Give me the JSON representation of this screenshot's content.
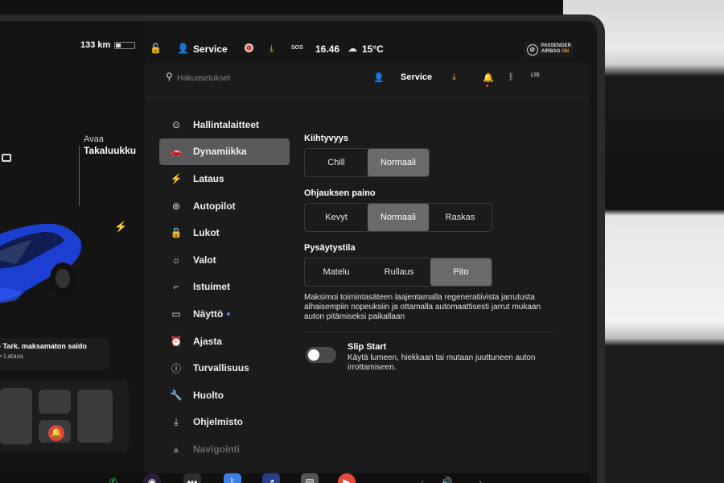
{
  "car": {
    "range": "133 km",
    "trunk_action": "Avaa",
    "trunk_label": "Takaluukku",
    "notice_title": "- Tark. maksamaton saldo",
    "notice_sub": "> Lataus",
    "paint_color": "#1d3fd1"
  },
  "statusbar": {
    "user": "Service",
    "sos": "SOS",
    "time": "16.46",
    "temp": "15°C",
    "airbag_line1": "PASSENGER",
    "airbag_line2": "AIRBAG",
    "airbag_state": "ON"
  },
  "header": {
    "search_placeholder": "Hakuasetukset",
    "user": "Service",
    "lte": "LTE"
  },
  "sidebar": {
    "items": [
      {
        "label": "Hallintalaitteet",
        "icon": "toggle-icon"
      },
      {
        "label": "Dynamiikka",
        "icon": "car-icon",
        "active": true
      },
      {
        "label": "Lataus",
        "icon": "bolt-icon"
      },
      {
        "label": "Autopilot",
        "icon": "steering-wheel-icon"
      },
      {
        "label": "Lukot",
        "icon": "lock-icon"
      },
      {
        "label": "Valot",
        "icon": "sun-icon"
      },
      {
        "label": "Istuimet",
        "icon": "seat-icon"
      },
      {
        "label": "Näyttö",
        "icon": "display-icon",
        "badge": true
      },
      {
        "label": "Ajasta",
        "icon": "alarm-clock-icon"
      },
      {
        "label": "Turvallisuus",
        "icon": "info-circle-icon"
      },
      {
        "label": "Huolto",
        "icon": "wrench-icon"
      },
      {
        "label": "Ohjelmisto",
        "icon": "download-icon"
      },
      {
        "label": "Navigointi",
        "icon": "navigation-arrow-icon"
      }
    ]
  },
  "dynamics": {
    "acceleration": {
      "title": "Kiihtyvyys",
      "options": [
        "Chill",
        "Normaali"
      ],
      "selected": "Normaali"
    },
    "steering": {
      "title": "Ohjauksen paino",
      "options": [
        "Kevyt",
        "Normaali",
        "Raskas"
      ],
      "selected": "Normaali"
    },
    "stopping": {
      "title": "Pysäytystila",
      "options": [
        "Matelu",
        "Rullaus",
        "Pito"
      ],
      "selected": "Pito",
      "description": "Maksimoi toimintasäteen laajentamalla regeneratiivista jarrutusta alhaisempiin nopeuksiin ja ottamalla automaattisesti jarrut mukaan auton pitämiseksi paikallaan"
    },
    "slip_start": {
      "title": "Slip Start",
      "description": "Käytä lumeen, hiekkaan tai mutaan juuttuneen auton irrottamiseen.",
      "enabled": false
    }
  },
  "colors": {
    "accent_orange": "#f0a024",
    "record_red": "#e64a3a",
    "selected_segment": "#6a6a6c",
    "badge_blue": "#3b8af0"
  }
}
